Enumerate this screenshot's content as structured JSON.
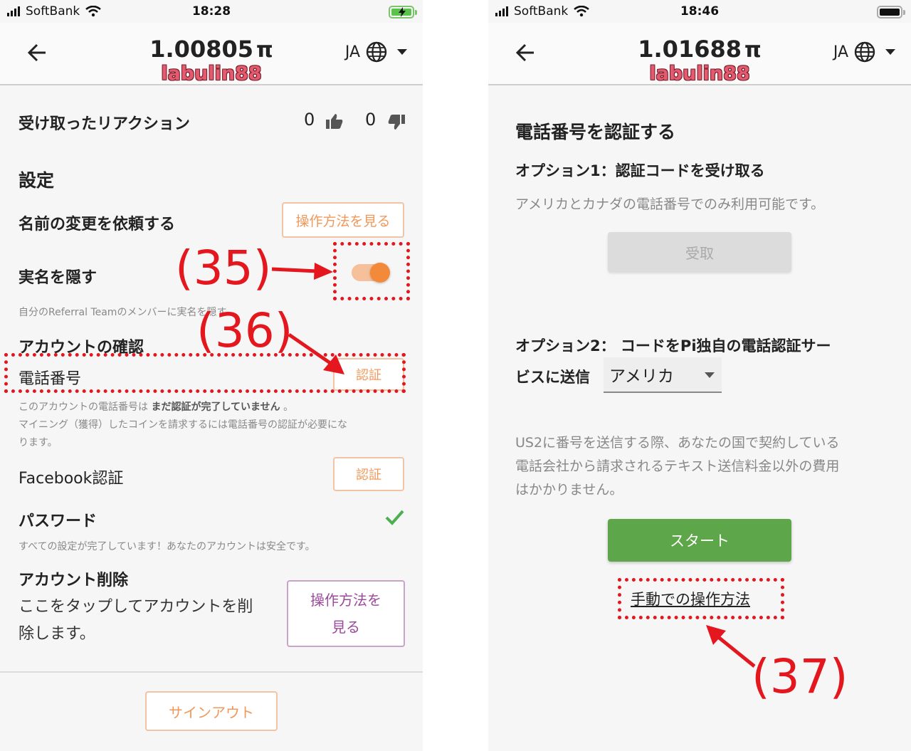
{
  "left": {
    "status": {
      "carrier": "SoftBank",
      "time": "18:28"
    },
    "header": {
      "balance": "1.00805",
      "pi_symbol": "π",
      "username": "labulin88",
      "lang": "JA"
    },
    "reactions": {
      "label": "受け取ったリアクション",
      "likes": "0",
      "dislikes": "0"
    },
    "settings": {
      "title": "設定",
      "rename_label": "名前の変更を依頼する",
      "rename_button": "操作方法を見る",
      "hide_name_label": "実名を隠す",
      "hide_name_on": true,
      "hide_name_desc": "自分のReferral Teamのメンバーに実名を隠す",
      "account_verify_title": "アカウントの確認",
      "phone_label": "電話番号",
      "phone_button": "認証",
      "phone_desc_prefix": "このアカウントの電話番号は",
      "phone_desc_bold": "まだ認証が完了していません",
      "phone_desc_suffix": "。",
      "phone_desc_line2": "マイニング（獲得）したコインを請求するには電話番号の認証が必要にな",
      "phone_desc_line3": "ります。",
      "facebook_label": "Facebook認証",
      "facebook_button": "認証",
      "password_label": "パスワード",
      "password_desc": "すべての設定が完了しています！あなたのアカウントは安全です。",
      "delete_title": "アカウント削除",
      "delete_line1": "ここをタップしてアカウントを削",
      "delete_line2": "除します。",
      "delete_button_line1": "操作方法を",
      "delete_button_line2": "見る",
      "signout_button": "サインアウト"
    },
    "annotations": {
      "a35": "(35)",
      "a36": "(36)"
    }
  },
  "right": {
    "status": {
      "carrier": "SoftBank",
      "time": "18:46"
    },
    "header": {
      "balance": "1.01688",
      "pi_symbol": "π",
      "username": "labulin88",
      "lang": "JA"
    },
    "verify": {
      "title": "電話番号を認証する",
      "option1_title": "オプション1：認証コードを受け取る",
      "option1_desc": "アメリカとカナダの電話番号でのみ利用可能です。",
      "receive_button": "受取",
      "option2_line1": "オプション2： コードをPi独自の電話認証サー",
      "option2_line2": "ビスに送信",
      "country_selected": "アメリカ",
      "fee_line1": "US2に番号を送信する際、あなたの国で契約している",
      "fee_line2": "電話会社から請求されるテキスト送信料金以外の費用",
      "fee_line3": "はかかりません。",
      "start_button": "スタート",
      "manual_link": "手動での操作方法"
    },
    "annotations": {
      "a37": "(37)"
    }
  },
  "colors": {
    "orange": "#f0985a",
    "annotation_red": "#e3171d",
    "green": "#5ea64a",
    "purple": "#9b4a9b"
  }
}
